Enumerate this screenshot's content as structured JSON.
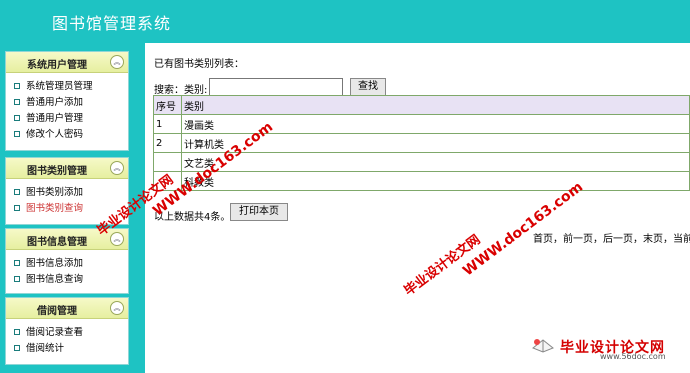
{
  "header": {
    "title": "图书馆管理系统"
  },
  "sidebar": {
    "panels": [
      {
        "title": "系统用户管理",
        "items": [
          "系统管理员管理",
          "普通用户添加",
          "普通用户管理",
          "修改个人密码"
        ]
      },
      {
        "title": "图书类别管理",
        "items": [
          "图书类别添加",
          "图书类别查询"
        ]
      },
      {
        "title": "图书信息管理",
        "items": [
          "图书信息添加",
          "图书信息查询"
        ]
      },
      {
        "title": "借阅管理",
        "items": [
          "借阅记录查看",
          "借阅统计"
        ]
      }
    ],
    "toggle_glyph": "︽"
  },
  "main": {
    "list_title": "已有图书类别列表：",
    "search_label": "搜索：类别:",
    "search_value": "",
    "search_button": "查找",
    "table": {
      "headers": [
        "序号",
        "类别"
      ],
      "rows": [
        [
          "1",
          "漫画类"
        ],
        [
          "2",
          "计算机类"
        ],
        [
          "",
          "文艺类"
        ],
        [
          "",
          "科教类"
        ]
      ]
    },
    "summary": "以上数据共4条。",
    "print_button": "打印本页",
    "pager": "首页，前一页，后一页，末页，当前"
  },
  "watermarks": {
    "site": "WWW.doc163.com",
    "text": "毕业设计论文网",
    "logo_text": "毕业设计论文网",
    "logo_url": "www.56doc.com"
  }
}
